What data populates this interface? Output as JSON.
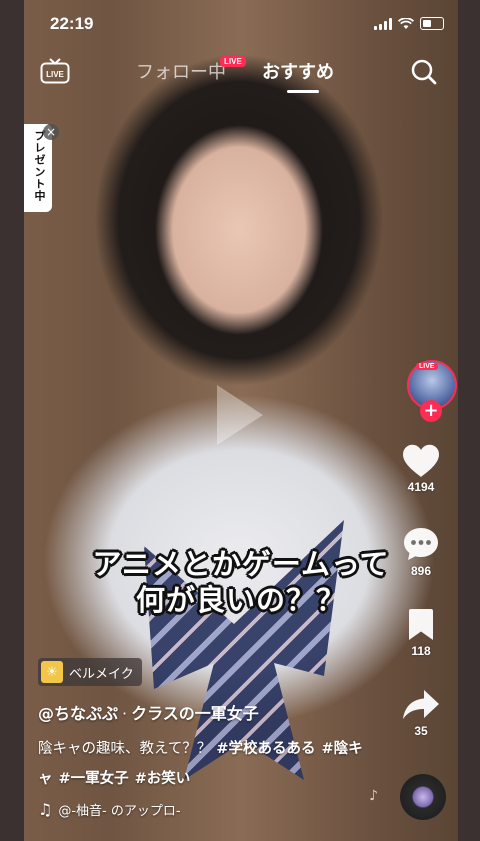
{
  "status_bar": {
    "time": "22:19"
  },
  "top_nav": {
    "live_icon_label": "LIVE",
    "tabs": [
      {
        "label": "フォロー中",
        "active": false
      },
      {
        "label": "おすすめ",
        "active": true
      }
    ],
    "live_badge": "LIVE",
    "search_icon": "search-icon"
  },
  "promo": {
    "label": "プレゼント中",
    "close": "×"
  },
  "video": {
    "caption_line1": "アニメとかゲームって",
    "caption_line2": "何が良いの？？"
  },
  "side_actions": {
    "avatar_live_badge": "LIVE",
    "follow_plus": "+",
    "likes": "4194",
    "comments": "896",
    "bookmarks": "118",
    "shares": "35"
  },
  "post": {
    "anchor_icon": "☀",
    "anchor_label": "ベルメイク",
    "username": "@ちなぷぷ",
    "separator": "·",
    "user_tagline": "クラスの一軍女子",
    "description_text": "陰キャの趣味、教えて？？",
    "hashtags": [
      "#学校あるある",
      "#陰キャ",
      "#一軍女子",
      "#お笑い"
    ],
    "music_note": "♫",
    "music_text": "@-柚音- のアップロ-"
  },
  "colors": {
    "accent": "#fe2c55",
    "text": "#ffffff",
    "anchor_icon_bg": "#f3c64a"
  }
}
